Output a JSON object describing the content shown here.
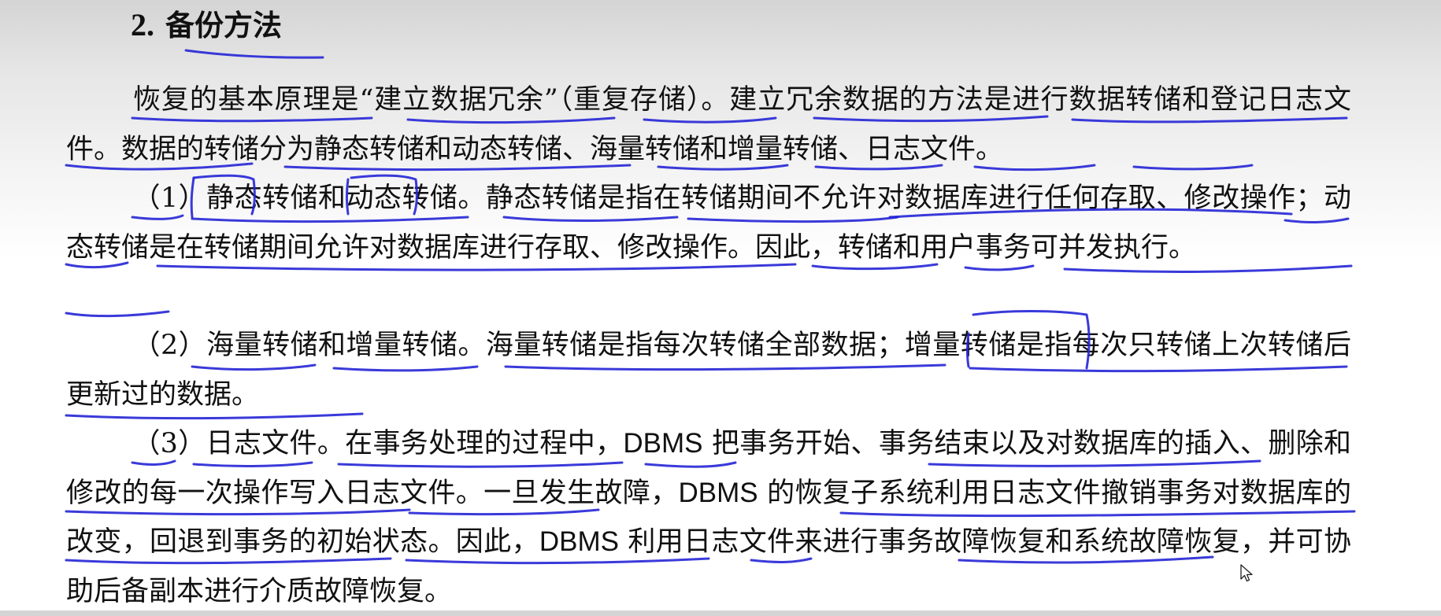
{
  "heading": {
    "number": "2.",
    "title": "备份方法"
  },
  "paragraphs": [
    {
      "text": "恢复的基本原理是“建立数据冗余”（重复存储）。建立冗余数据的方法是进行数据转储和登记日志文件。数据的转储分为静态转储和动态转储、海量转储和增量转储、日志文件。"
    },
    {
      "text": "（1）静态转储和动态转储。静态转储是指在转储期间不允许对数据库进行任何存取、修改操作；动态转储是在转储期间允许对数据库进行存取、修改操作。因此，转储和用户事务可并发执行。"
    },
    {
      "text": "（2）海量转储和增量转储。海量转储是指每次转储全部数据；增量转储是指每次只转储上次转储后更新过的数据。"
    },
    {
      "text_before": "（3）日志文件。在事务处理的过程中，",
      "dbms_1": "DBMS",
      "text_mid_1": "把事务开始、事务结束以及对数据库的插入、删除和修改的每一次操作写入日志文件。一旦发生故障，",
      "dbms_2": "DBMS",
      "text_mid_2": "的恢复子系统利用日志文件撤销事务对数据库的改变，回退到事务的初始状态。因此，",
      "dbms_3": "DBMS",
      "text_after": "利用日志文件来进行事务故障恢复和系统故障恢复，并可协助后备副本进行介质故障恢复。"
    }
  ],
  "annotation_color": "#2525d6",
  "icons": {
    "cursor": "mouse-pointer-icon"
  }
}
